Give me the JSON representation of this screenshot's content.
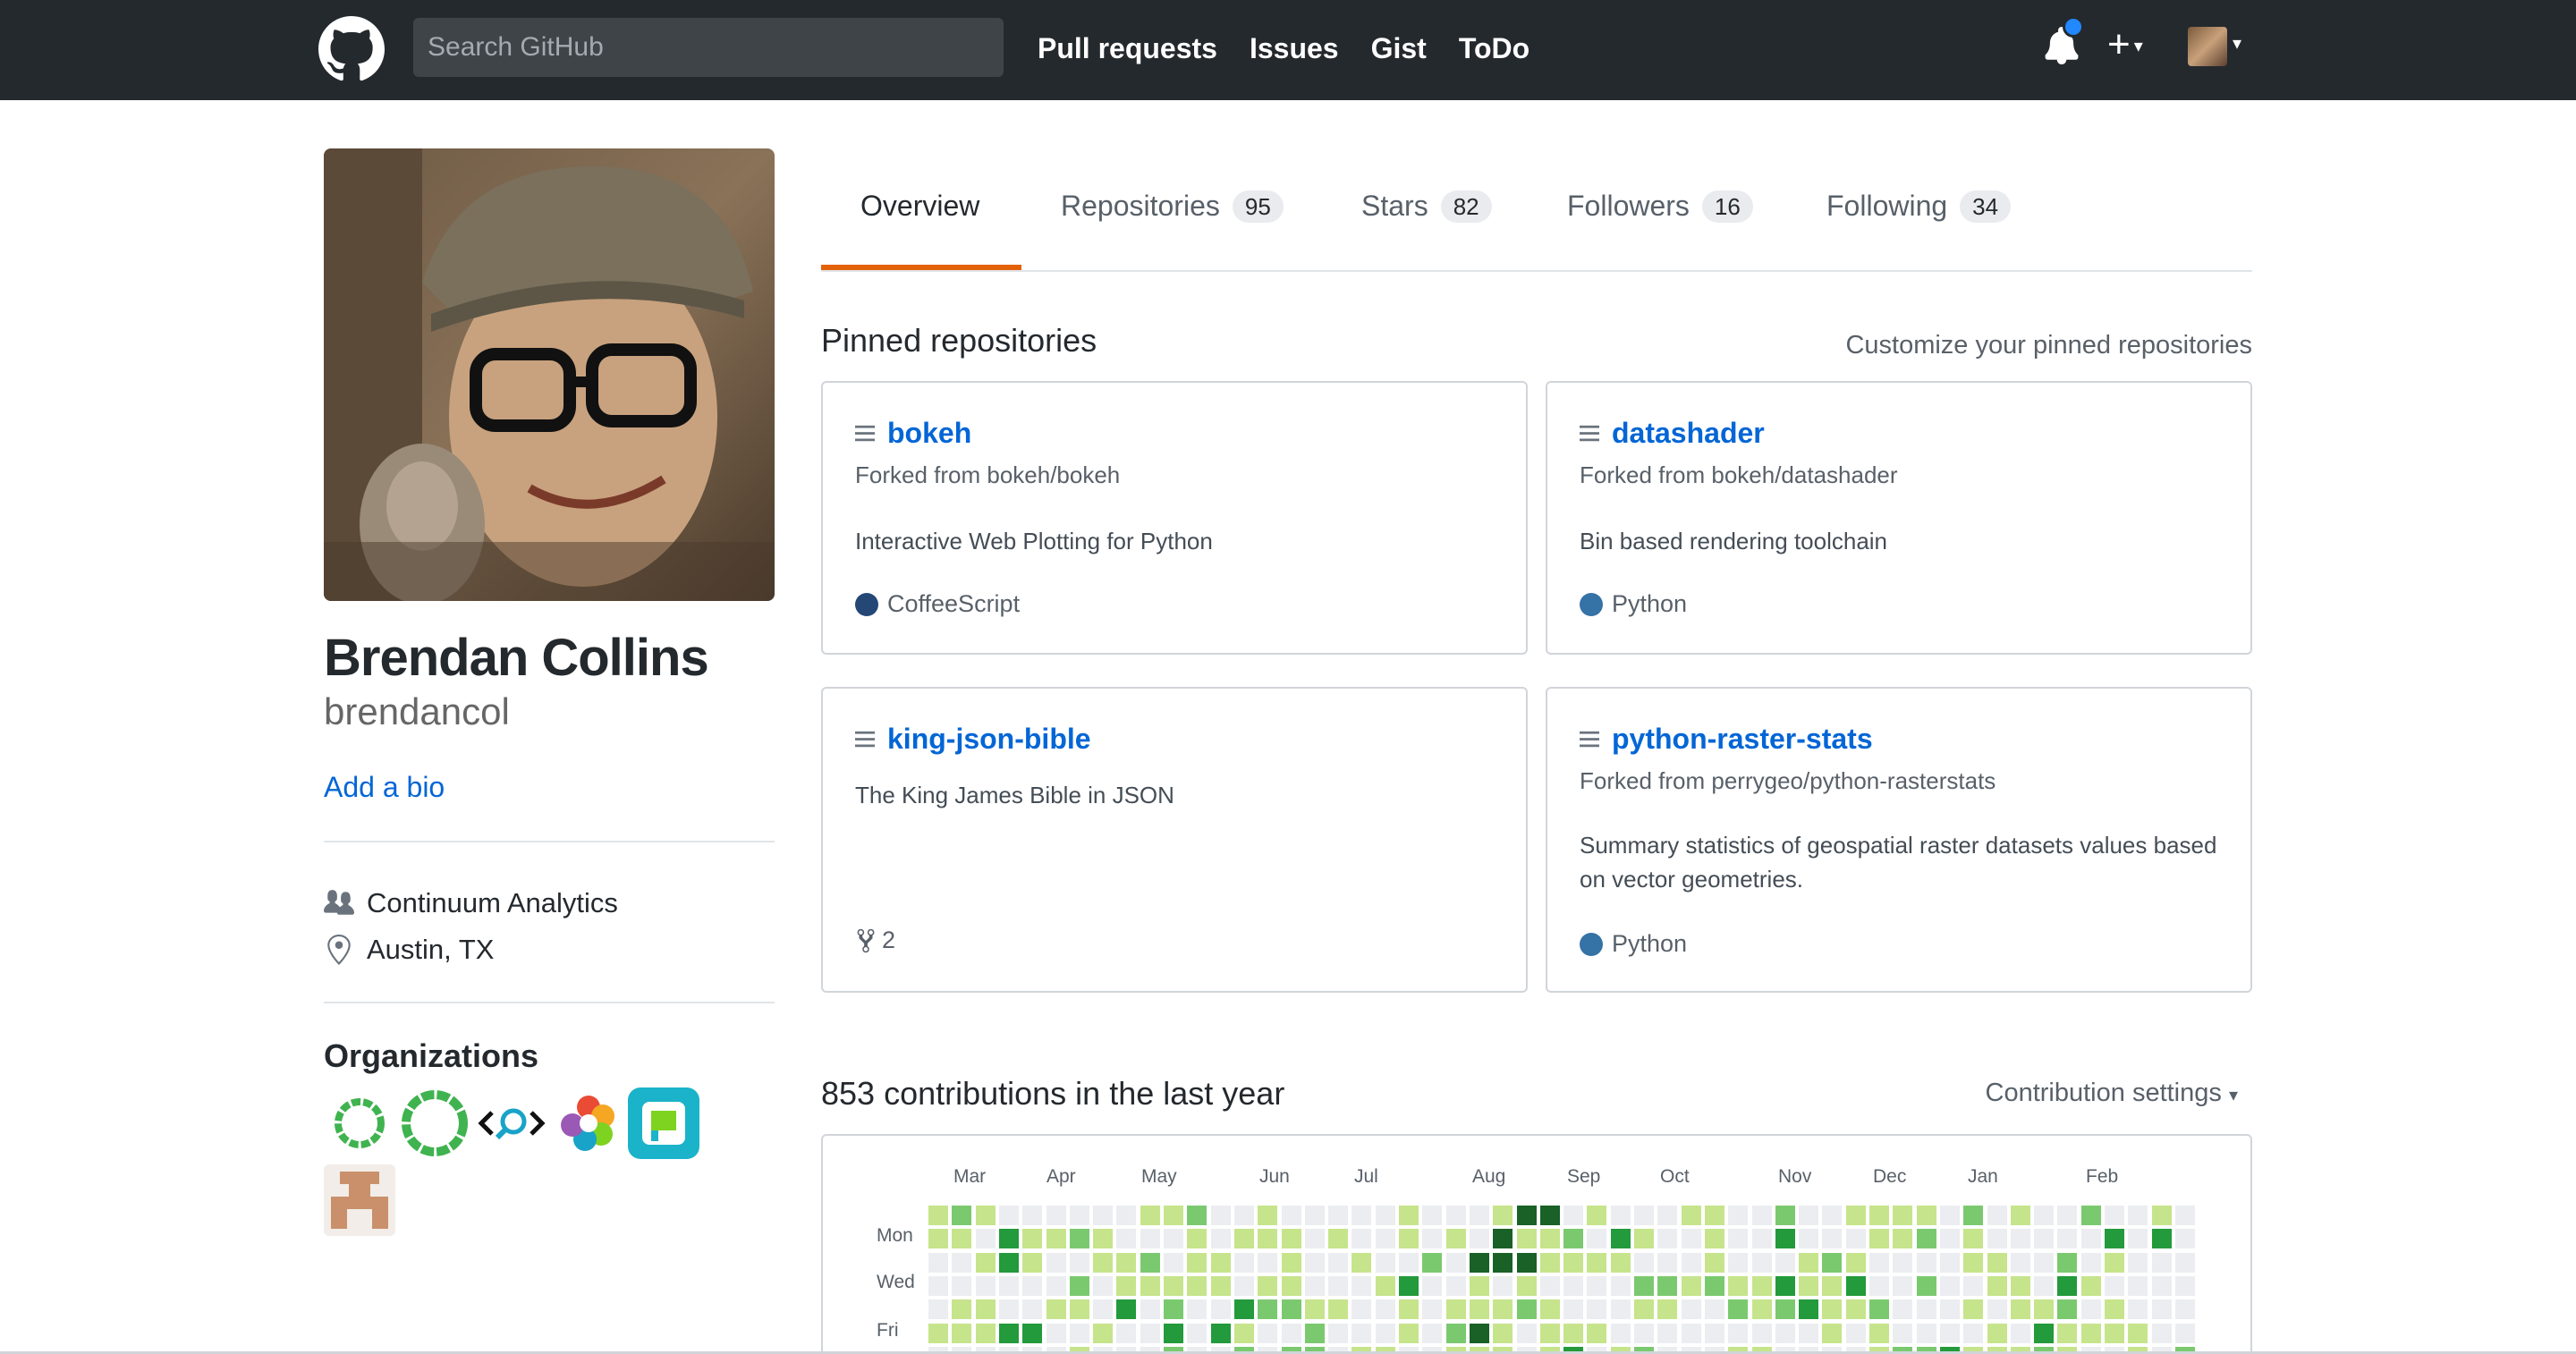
{
  "header": {
    "search_placeholder": "Search GitHub",
    "nav": [
      "Pull requests",
      "Issues",
      "Gist",
      "ToDo"
    ],
    "icons": {
      "logo": "github-octocat-icon",
      "notifications": "bell-icon",
      "create": "plus-icon"
    },
    "notification_dot_color": "#2188ff"
  },
  "profile": {
    "full_name": "Brendan Collins",
    "username": "brendancol",
    "add_bio": "Add a bio",
    "company": "Continuum Analytics",
    "location": "Austin, TX",
    "organizations_title": "Organizations"
  },
  "tabs": [
    {
      "label": "Overview",
      "count": null
    },
    {
      "label": "Repositories",
      "count": "95"
    },
    {
      "label": "Stars",
      "count": "82"
    },
    {
      "label": "Followers",
      "count": "16"
    },
    {
      "label": "Following",
      "count": "34"
    }
  ],
  "pinned": {
    "title": "Pinned repositories",
    "customize": "Customize your pinned repositories",
    "repos": [
      {
        "name": "bokeh",
        "forked": "Forked from bokeh/bokeh",
        "description": "Interactive Web Plotting for Python",
        "language": "CoffeeScript",
        "language_color": "#244776"
      },
      {
        "name": "datashader",
        "forked": "Forked from bokeh/datashader",
        "description": "Bin based rendering toolchain",
        "language": "Python",
        "language_color": "#3572A5"
      },
      {
        "name": "king-json-bible",
        "forked": "",
        "description": "The King James Bible in JSON",
        "forks": "2"
      },
      {
        "name": "python-raster-stats",
        "forked": "Forked from perrygeo/python-rasterstats",
        "description": "Summary statistics of geospatial raster datasets values based on vector geometries.",
        "language": "Python",
        "language_color": "#3572A5"
      }
    ]
  },
  "contributions": {
    "title": "853 contributions in the last year",
    "settings": "Contribution settings",
    "months": [
      "Mar",
      "Apr",
      "May",
      "Jun",
      "Jul",
      "Aug",
      "Sep",
      "Oct",
      "Nov",
      "Dec",
      "Jan",
      "Feb"
    ],
    "days": [
      "Mon",
      "Wed",
      "Fri"
    ],
    "palette": [
      "#ebedf0",
      "#c6e48b",
      "#7bc96f",
      "#239a3b",
      "#196127"
    ]
  }
}
